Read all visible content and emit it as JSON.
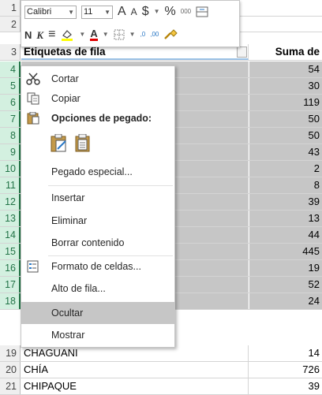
{
  "sheet": {
    "header_row": {
      "num": "3",
      "a": "Etiquetas de fila",
      "b": "Suma de Total"
    },
    "rows": [
      {
        "num": "4",
        "a": "",
        "b": "54"
      },
      {
        "num": "5",
        "a": "",
        "b": "30"
      },
      {
        "num": "6",
        "a": "",
        "b": "119"
      },
      {
        "num": "7",
        "a": "",
        "b": "50"
      },
      {
        "num": "8",
        "a": "",
        "b": "50"
      },
      {
        "num": "9",
        "a": "",
        "b": "43"
      },
      {
        "num": "10",
        "a": "",
        "b": "2"
      },
      {
        "num": "11",
        "a": "",
        "b": "8"
      },
      {
        "num": "12",
        "a": "",
        "b": "39"
      },
      {
        "num": "13",
        "a": "",
        "b": "13"
      },
      {
        "num": "14",
        "a": "",
        "b": "44"
      },
      {
        "num": "15",
        "a": "",
        "b": "445"
      },
      {
        "num": "16",
        "a": "",
        "b": "19"
      },
      {
        "num": "17",
        "a": "",
        "b": "52"
      },
      {
        "num": "18",
        "a": "",
        "b": "24"
      },
      {
        "num": "19",
        "a": "CHAGUANI",
        "b": "14"
      },
      {
        "num": "20",
        "a": "CHÍA",
        "b": "726"
      },
      {
        "num": "21",
        "a": "CHIPAQUE",
        "b": "39"
      }
    ],
    "top_rows": [
      "1",
      "2"
    ]
  },
  "mini_toolbar": {
    "font_name": "Calibri",
    "font_size": "11",
    "grow_font": "A",
    "shrink_font": "A",
    "currency": "$",
    "percent": "%",
    "thousands": "000",
    "bold": "N",
    "italic": "K",
    "align": "≡",
    "font_color": "A",
    "inc_decimal": ",0",
    "dec_decimal": ",00"
  },
  "context_menu": {
    "items": [
      {
        "label": "Cortar",
        "icon": "scissors-icon"
      },
      {
        "label": "Copiar",
        "icon": "copy-icon"
      },
      {
        "label": "Opciones de pegado:",
        "icon": "paste-icon"
      },
      {
        "label": "Pegado especial...",
        "icon": ""
      },
      {
        "label": "Insertar",
        "icon": ""
      },
      {
        "label": "Eliminar",
        "icon": ""
      },
      {
        "label": "Borrar contenido",
        "icon": ""
      },
      {
        "label": "Formato de celdas...",
        "icon": "format-cells-icon"
      },
      {
        "label": "Alto de fila...",
        "icon": ""
      },
      {
        "label": "Ocultar",
        "icon": ""
      },
      {
        "label": "Mostrar",
        "icon": ""
      }
    ],
    "hovered": "Ocultar"
  },
  "colors": {
    "selection": "#c6c6c6",
    "accent_green": "#217346",
    "header_border": "#9bc2e6"
  }
}
